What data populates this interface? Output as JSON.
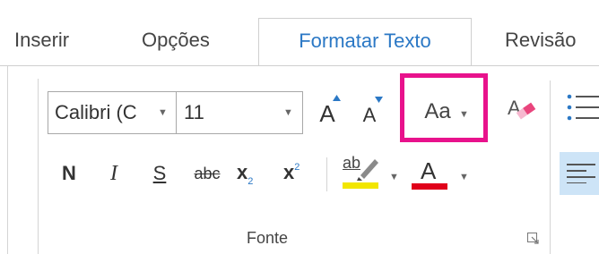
{
  "tabs": [
    {
      "label": "Inserir",
      "active": false
    },
    {
      "label": "Opções",
      "active": false
    },
    {
      "label": "Formatar Texto",
      "active": true
    },
    {
      "label": "Revisão",
      "active": false
    }
  ],
  "font_group": {
    "font_name": "Calibri (C",
    "font_size": "11",
    "grow_font_label": "A",
    "shrink_font_label": "A",
    "change_case_label": "Aa",
    "bold_label": "N",
    "italic_label": "I",
    "underline_label": "S",
    "strike_label": "abc",
    "subscript_label": "x",
    "subscript_mark": "2",
    "superscript_label": "x",
    "superscript_mark": "2",
    "highlight_label": "ab",
    "font_color_label": "A",
    "group_label": "Fonte"
  },
  "colors": {
    "accent": "#2b78c5",
    "highlight_frame": "#e8128c",
    "highlight_yellow": "#f2e600",
    "font_color_red": "#e0001b"
  },
  "icons": [
    "chevron-down-icon",
    "clear-formatting-icon",
    "bullets-icon",
    "align-left-icon",
    "dialog-launcher-icon"
  ]
}
